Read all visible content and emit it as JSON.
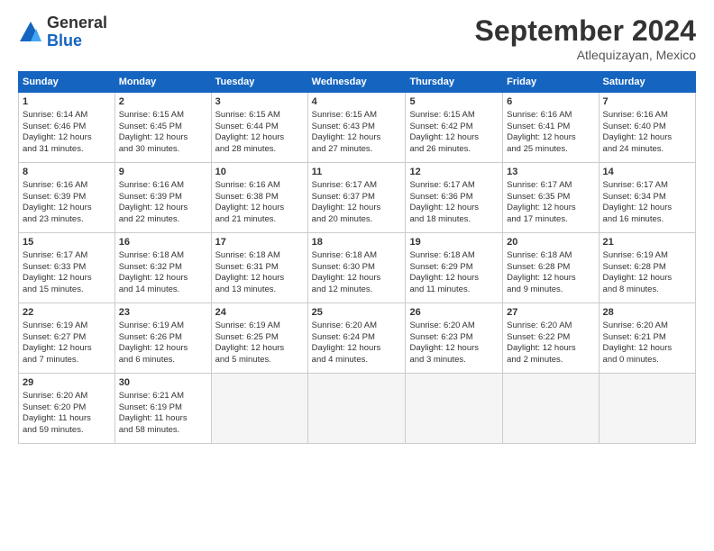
{
  "logo": {
    "general": "General",
    "blue": "Blue"
  },
  "header": {
    "title": "September 2024",
    "location": "Atlequizayan, Mexico"
  },
  "days": [
    "Sunday",
    "Monday",
    "Tuesday",
    "Wednesday",
    "Thursday",
    "Friday",
    "Saturday"
  ],
  "weeks": [
    [
      {
        "day": 1,
        "lines": [
          "Sunrise: 6:14 AM",
          "Sunset: 6:46 PM",
          "Daylight: 12 hours",
          "and 31 minutes."
        ]
      },
      {
        "day": 2,
        "lines": [
          "Sunrise: 6:15 AM",
          "Sunset: 6:45 PM",
          "Daylight: 12 hours",
          "and 30 minutes."
        ]
      },
      {
        "day": 3,
        "lines": [
          "Sunrise: 6:15 AM",
          "Sunset: 6:44 PM",
          "Daylight: 12 hours",
          "and 28 minutes."
        ]
      },
      {
        "day": 4,
        "lines": [
          "Sunrise: 6:15 AM",
          "Sunset: 6:43 PM",
          "Daylight: 12 hours",
          "and 27 minutes."
        ]
      },
      {
        "day": 5,
        "lines": [
          "Sunrise: 6:15 AM",
          "Sunset: 6:42 PM",
          "Daylight: 12 hours",
          "and 26 minutes."
        ]
      },
      {
        "day": 6,
        "lines": [
          "Sunrise: 6:16 AM",
          "Sunset: 6:41 PM",
          "Daylight: 12 hours",
          "and 25 minutes."
        ]
      },
      {
        "day": 7,
        "lines": [
          "Sunrise: 6:16 AM",
          "Sunset: 6:40 PM",
          "Daylight: 12 hours",
          "and 24 minutes."
        ]
      }
    ],
    [
      {
        "day": 8,
        "lines": [
          "Sunrise: 6:16 AM",
          "Sunset: 6:39 PM",
          "Daylight: 12 hours",
          "and 23 minutes."
        ]
      },
      {
        "day": 9,
        "lines": [
          "Sunrise: 6:16 AM",
          "Sunset: 6:39 PM",
          "Daylight: 12 hours",
          "and 22 minutes."
        ]
      },
      {
        "day": 10,
        "lines": [
          "Sunrise: 6:16 AM",
          "Sunset: 6:38 PM",
          "Daylight: 12 hours",
          "and 21 minutes."
        ]
      },
      {
        "day": 11,
        "lines": [
          "Sunrise: 6:17 AM",
          "Sunset: 6:37 PM",
          "Daylight: 12 hours",
          "and 20 minutes."
        ]
      },
      {
        "day": 12,
        "lines": [
          "Sunrise: 6:17 AM",
          "Sunset: 6:36 PM",
          "Daylight: 12 hours",
          "and 18 minutes."
        ]
      },
      {
        "day": 13,
        "lines": [
          "Sunrise: 6:17 AM",
          "Sunset: 6:35 PM",
          "Daylight: 12 hours",
          "and 17 minutes."
        ]
      },
      {
        "day": 14,
        "lines": [
          "Sunrise: 6:17 AM",
          "Sunset: 6:34 PM",
          "Daylight: 12 hours",
          "and 16 minutes."
        ]
      }
    ],
    [
      {
        "day": 15,
        "lines": [
          "Sunrise: 6:17 AM",
          "Sunset: 6:33 PM",
          "Daylight: 12 hours",
          "and 15 minutes."
        ]
      },
      {
        "day": 16,
        "lines": [
          "Sunrise: 6:18 AM",
          "Sunset: 6:32 PM",
          "Daylight: 12 hours",
          "and 14 minutes."
        ]
      },
      {
        "day": 17,
        "lines": [
          "Sunrise: 6:18 AM",
          "Sunset: 6:31 PM",
          "Daylight: 12 hours",
          "and 13 minutes."
        ]
      },
      {
        "day": 18,
        "lines": [
          "Sunrise: 6:18 AM",
          "Sunset: 6:30 PM",
          "Daylight: 12 hours",
          "and 12 minutes."
        ]
      },
      {
        "day": 19,
        "lines": [
          "Sunrise: 6:18 AM",
          "Sunset: 6:29 PM",
          "Daylight: 12 hours",
          "and 11 minutes."
        ]
      },
      {
        "day": 20,
        "lines": [
          "Sunrise: 6:18 AM",
          "Sunset: 6:28 PM",
          "Daylight: 12 hours",
          "and 9 minutes."
        ]
      },
      {
        "day": 21,
        "lines": [
          "Sunrise: 6:19 AM",
          "Sunset: 6:28 PM",
          "Daylight: 12 hours",
          "and 8 minutes."
        ]
      }
    ],
    [
      {
        "day": 22,
        "lines": [
          "Sunrise: 6:19 AM",
          "Sunset: 6:27 PM",
          "Daylight: 12 hours",
          "and 7 minutes."
        ]
      },
      {
        "day": 23,
        "lines": [
          "Sunrise: 6:19 AM",
          "Sunset: 6:26 PM",
          "Daylight: 12 hours",
          "and 6 minutes."
        ]
      },
      {
        "day": 24,
        "lines": [
          "Sunrise: 6:19 AM",
          "Sunset: 6:25 PM",
          "Daylight: 12 hours",
          "and 5 minutes."
        ]
      },
      {
        "day": 25,
        "lines": [
          "Sunrise: 6:20 AM",
          "Sunset: 6:24 PM",
          "Daylight: 12 hours",
          "and 4 minutes."
        ]
      },
      {
        "day": 26,
        "lines": [
          "Sunrise: 6:20 AM",
          "Sunset: 6:23 PM",
          "Daylight: 12 hours",
          "and 3 minutes."
        ]
      },
      {
        "day": 27,
        "lines": [
          "Sunrise: 6:20 AM",
          "Sunset: 6:22 PM",
          "Daylight: 12 hours",
          "and 2 minutes."
        ]
      },
      {
        "day": 28,
        "lines": [
          "Sunrise: 6:20 AM",
          "Sunset: 6:21 PM",
          "Daylight: 12 hours",
          "and 0 minutes."
        ]
      }
    ],
    [
      {
        "day": 29,
        "lines": [
          "Sunrise: 6:20 AM",
          "Sunset: 6:20 PM",
          "Daylight: 11 hours",
          "and 59 minutes."
        ]
      },
      {
        "day": 30,
        "lines": [
          "Sunrise: 6:21 AM",
          "Sunset: 6:19 PM",
          "Daylight: 11 hours",
          "and 58 minutes."
        ]
      },
      null,
      null,
      null,
      null,
      null
    ]
  ]
}
